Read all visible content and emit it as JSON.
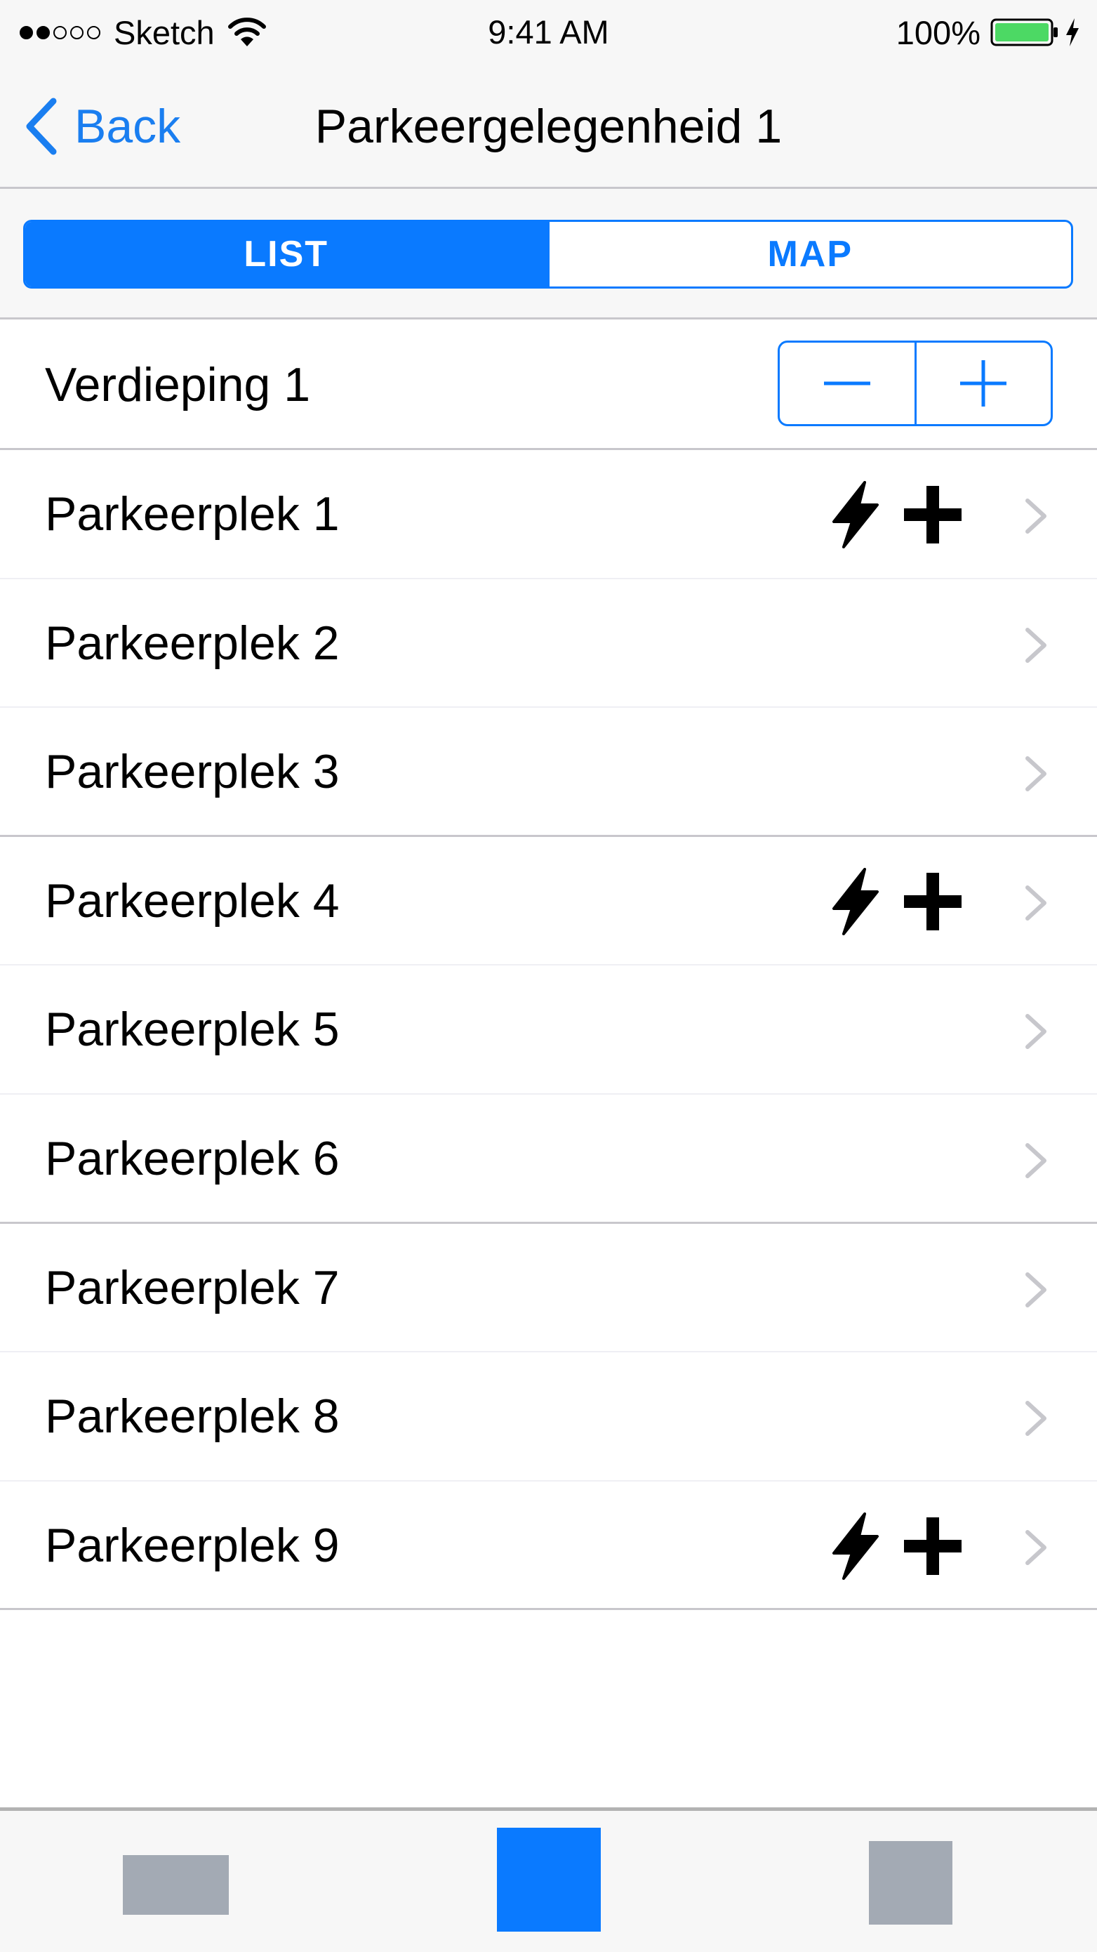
{
  "status_bar": {
    "carrier": "Sketch",
    "time": "9:41 AM",
    "battery": "100%"
  },
  "nav": {
    "back_label": "Back",
    "title": "Parkeergelegenheid 1"
  },
  "segments": {
    "list_label": "LIST",
    "map_label": "MAP",
    "selected": "LIST"
  },
  "floor": {
    "label": "Verdieping 1"
  },
  "spots": [
    {
      "label": "Parkeerplek 1",
      "icons": [
        "bolt-icon",
        "plus-icon"
      ]
    },
    {
      "label": "Parkeerplek 2",
      "icons": []
    },
    {
      "label": "Parkeerplek 3",
      "icons": []
    },
    {
      "label": "Parkeerplek 4",
      "icons": [
        "bolt-icon",
        "plus-icon"
      ]
    },
    {
      "label": "Parkeerplek 5",
      "icons": []
    },
    {
      "label": "Parkeerplek 6",
      "icons": []
    },
    {
      "label": "Parkeerplek 7",
      "icons": []
    },
    {
      "label": "Parkeerplek 8",
      "icons": []
    },
    {
      "label": "Parkeerplek 9",
      "icons": [
        "bolt-icon",
        "plus-icon"
      ]
    }
  ],
  "tab_bar": {
    "selected_index": 1,
    "colors": {
      "active": "#0a7aff",
      "inactive": "#a3aab4"
    }
  },
  "colors": {
    "accent": "#0a7aff",
    "battery": "#4cd964"
  }
}
